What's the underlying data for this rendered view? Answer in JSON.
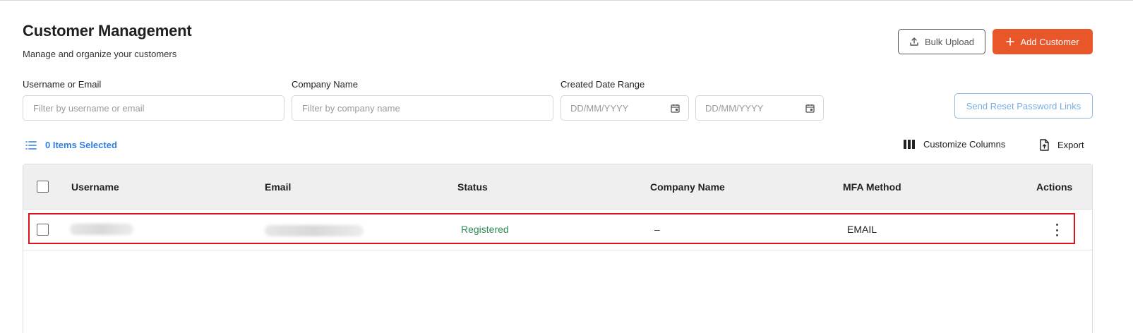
{
  "header": {
    "title": "Customer Management",
    "subtitle": "Manage and organize your customers",
    "bulk_upload_label": "Bulk Upload",
    "add_customer_label": "Add Customer"
  },
  "filters": {
    "username": {
      "label": "Username or Email",
      "placeholder": "Filter by username or email"
    },
    "company": {
      "label": "Company Name",
      "placeholder": "Filter by company name"
    },
    "date_range": {
      "label": "Created Date Range",
      "from_placeholder": "DD/MM/YYYY",
      "to_placeholder": "DD/MM/YYYY"
    },
    "reset_button_label": "Send Reset Password Links"
  },
  "toolbar": {
    "selected_label": "0 Items Selected",
    "customize_label": "Customize Columns",
    "export_label": "Export"
  },
  "table": {
    "columns": [
      "Username",
      "Email",
      "Status",
      "Company Name",
      "MFA Method",
      "Actions"
    ],
    "rows": [
      {
        "status": "Registered",
        "company": "–",
        "mfa": "EMAIL"
      }
    ]
  },
  "colors": {
    "accent": "#e8562a",
    "link": "#2f7fe0",
    "status_registered": "#2e8b57",
    "highlight": "#d9141e"
  }
}
